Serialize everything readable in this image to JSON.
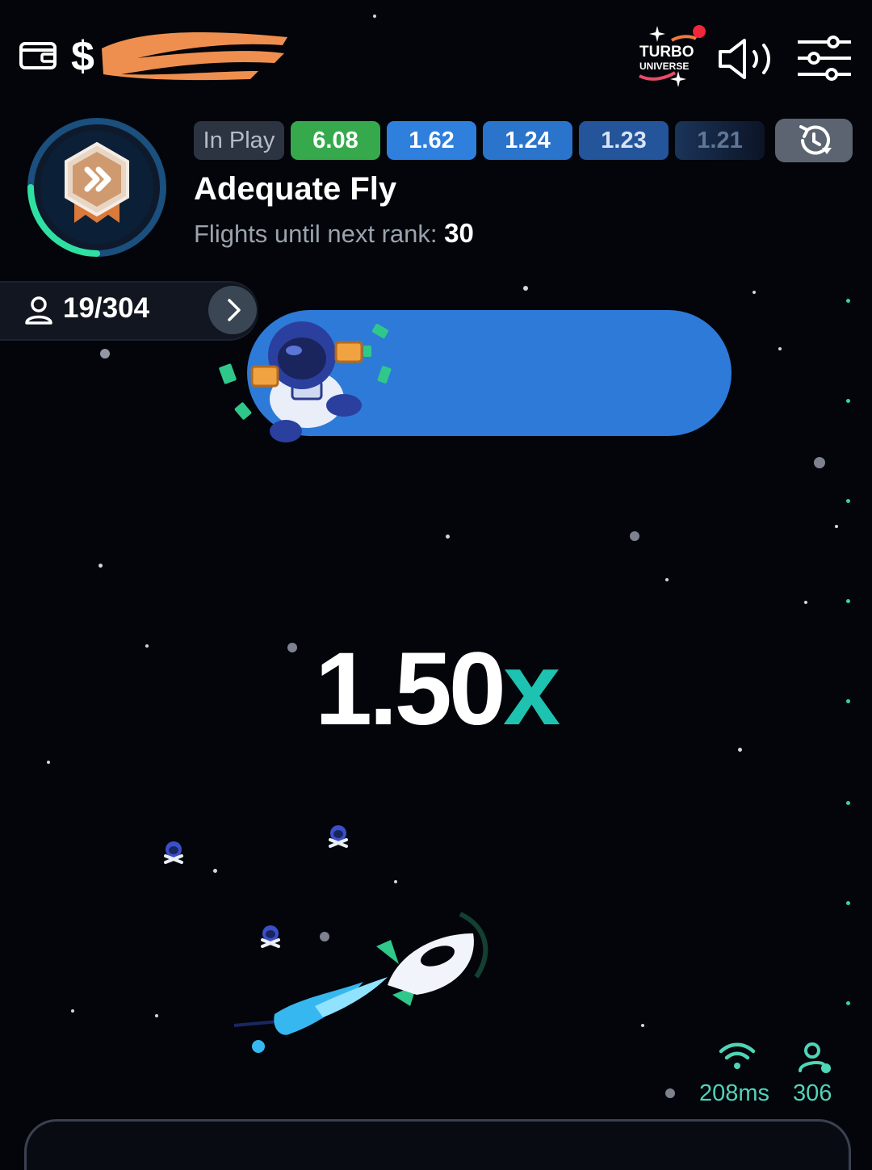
{
  "header": {
    "currency_symbol": "$",
    "logo_line1": "TURBO",
    "logo_line2": "UNIVERSE"
  },
  "rank": {
    "name": "Adequate Fly",
    "progress_label": "Flights until next rank:",
    "progress_value": "30"
  },
  "history": {
    "in_play_label": "In Play",
    "multipliers": [
      "6.08",
      "1.62",
      "1.24",
      "1.23",
      "1.21"
    ]
  },
  "players": {
    "count": "19/304"
  },
  "game": {
    "multiplier_value": "1.50",
    "multiplier_suffix": "x"
  },
  "status": {
    "ping": "208ms",
    "online": "306"
  },
  "colors": {
    "accent_green": "#35a94c",
    "accent_blue": "#2f7fdd",
    "multiplier_x": "#1ec2b0",
    "status_text": "#51d3b7"
  },
  "icons": [
    "wallet-icon",
    "sound-icon",
    "settings-icon",
    "history-icon",
    "user-icon",
    "chevron-right-icon",
    "wifi-icon",
    "online-users-icon"
  ]
}
